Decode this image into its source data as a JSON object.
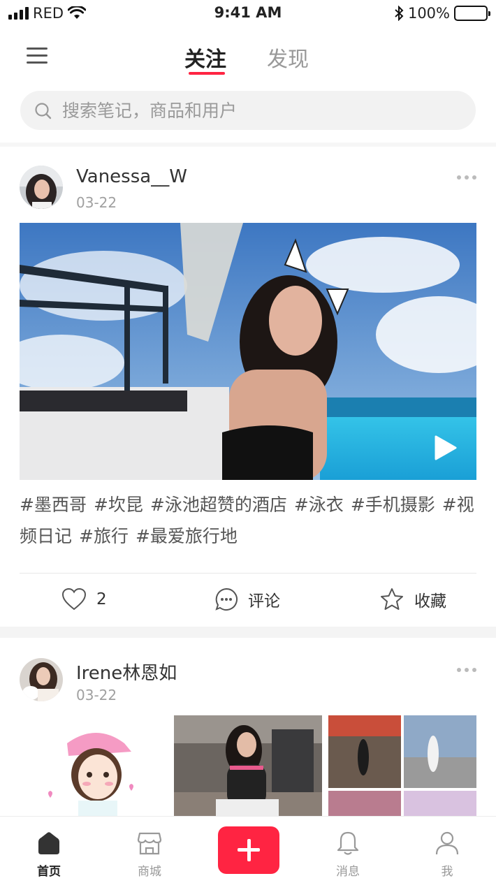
{
  "status_bar": {
    "carrier": "RED",
    "time": "9:41 AM",
    "battery": "100%"
  },
  "nav": {
    "tabs": [
      {
        "label": "关注",
        "active": true
      },
      {
        "label": "发现",
        "active": false
      }
    ]
  },
  "search": {
    "placeholder": "搜索笔记，商品和用户"
  },
  "posts": [
    {
      "username": "Vanessa__W",
      "date": "03-22",
      "media_type": "video",
      "tags": [
        "#墨西哥",
        "#坎昆",
        "#泳池超赞的酒店",
        "#泳衣",
        "#手机摄影",
        "#视频日记",
        "#旅行",
        "#最爱旅行地"
      ],
      "actions": {
        "like_count": "2",
        "comment_label": "评论",
        "collect_label": "收藏"
      }
    },
    {
      "username": "Irene林恩如",
      "date": "03-22",
      "media_type": "images"
    }
  ],
  "tab_bar": {
    "items": [
      {
        "label": "首页",
        "icon": "home-icon",
        "active": true
      },
      {
        "label": "商城",
        "icon": "store-icon",
        "active": false
      },
      {
        "label": "消息",
        "icon": "bell-icon",
        "active": false
      },
      {
        "label": "我",
        "icon": "user-icon",
        "active": false
      }
    ],
    "add_icon": "plus-icon"
  },
  "colors": {
    "accent": "#ff2442",
    "text_primary": "#222222",
    "text_secondary": "#999999"
  }
}
